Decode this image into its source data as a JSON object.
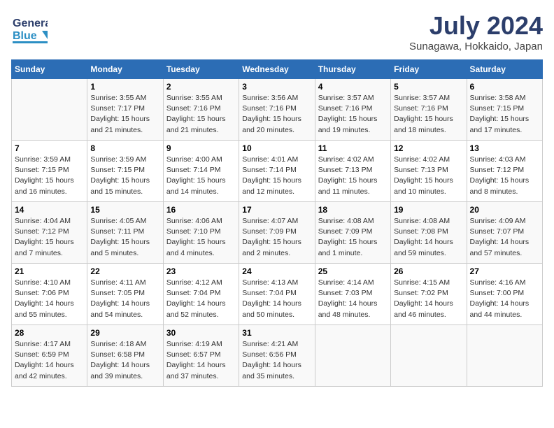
{
  "logo": {
    "line1": "General",
    "line2": "Blue"
  },
  "title": "July 2024",
  "subtitle": "Sunagawa, Hokkaido, Japan",
  "weekdays": [
    "Sunday",
    "Monday",
    "Tuesday",
    "Wednesday",
    "Thursday",
    "Friday",
    "Saturday"
  ],
  "weeks": [
    [
      {
        "day": "",
        "info": ""
      },
      {
        "day": "1",
        "info": "Sunrise: 3:55 AM\nSunset: 7:17 PM\nDaylight: 15 hours\nand 21 minutes."
      },
      {
        "day": "2",
        "info": "Sunrise: 3:55 AM\nSunset: 7:16 PM\nDaylight: 15 hours\nand 21 minutes."
      },
      {
        "day": "3",
        "info": "Sunrise: 3:56 AM\nSunset: 7:16 PM\nDaylight: 15 hours\nand 20 minutes."
      },
      {
        "day": "4",
        "info": "Sunrise: 3:57 AM\nSunset: 7:16 PM\nDaylight: 15 hours\nand 19 minutes."
      },
      {
        "day": "5",
        "info": "Sunrise: 3:57 AM\nSunset: 7:16 PM\nDaylight: 15 hours\nand 18 minutes."
      },
      {
        "day": "6",
        "info": "Sunrise: 3:58 AM\nSunset: 7:15 PM\nDaylight: 15 hours\nand 17 minutes."
      }
    ],
    [
      {
        "day": "7",
        "info": "Sunrise: 3:59 AM\nSunset: 7:15 PM\nDaylight: 15 hours\nand 16 minutes."
      },
      {
        "day": "8",
        "info": "Sunrise: 3:59 AM\nSunset: 7:15 PM\nDaylight: 15 hours\nand 15 minutes."
      },
      {
        "day": "9",
        "info": "Sunrise: 4:00 AM\nSunset: 7:14 PM\nDaylight: 15 hours\nand 14 minutes."
      },
      {
        "day": "10",
        "info": "Sunrise: 4:01 AM\nSunset: 7:14 PM\nDaylight: 15 hours\nand 12 minutes."
      },
      {
        "day": "11",
        "info": "Sunrise: 4:02 AM\nSunset: 7:13 PM\nDaylight: 15 hours\nand 11 minutes."
      },
      {
        "day": "12",
        "info": "Sunrise: 4:02 AM\nSunset: 7:13 PM\nDaylight: 15 hours\nand 10 minutes."
      },
      {
        "day": "13",
        "info": "Sunrise: 4:03 AM\nSunset: 7:12 PM\nDaylight: 15 hours\nand 8 minutes."
      }
    ],
    [
      {
        "day": "14",
        "info": "Sunrise: 4:04 AM\nSunset: 7:12 PM\nDaylight: 15 hours\nand 7 minutes."
      },
      {
        "day": "15",
        "info": "Sunrise: 4:05 AM\nSunset: 7:11 PM\nDaylight: 15 hours\nand 5 minutes."
      },
      {
        "day": "16",
        "info": "Sunrise: 4:06 AM\nSunset: 7:10 PM\nDaylight: 15 hours\nand 4 minutes."
      },
      {
        "day": "17",
        "info": "Sunrise: 4:07 AM\nSunset: 7:09 PM\nDaylight: 15 hours\nand 2 minutes."
      },
      {
        "day": "18",
        "info": "Sunrise: 4:08 AM\nSunset: 7:09 PM\nDaylight: 15 hours\nand 1 minute."
      },
      {
        "day": "19",
        "info": "Sunrise: 4:08 AM\nSunset: 7:08 PM\nDaylight: 14 hours\nand 59 minutes."
      },
      {
        "day": "20",
        "info": "Sunrise: 4:09 AM\nSunset: 7:07 PM\nDaylight: 14 hours\nand 57 minutes."
      }
    ],
    [
      {
        "day": "21",
        "info": "Sunrise: 4:10 AM\nSunset: 7:06 PM\nDaylight: 14 hours\nand 55 minutes."
      },
      {
        "day": "22",
        "info": "Sunrise: 4:11 AM\nSunset: 7:05 PM\nDaylight: 14 hours\nand 54 minutes."
      },
      {
        "day": "23",
        "info": "Sunrise: 4:12 AM\nSunset: 7:04 PM\nDaylight: 14 hours\nand 52 minutes."
      },
      {
        "day": "24",
        "info": "Sunrise: 4:13 AM\nSunset: 7:04 PM\nDaylight: 14 hours\nand 50 minutes."
      },
      {
        "day": "25",
        "info": "Sunrise: 4:14 AM\nSunset: 7:03 PM\nDaylight: 14 hours\nand 48 minutes."
      },
      {
        "day": "26",
        "info": "Sunrise: 4:15 AM\nSunset: 7:02 PM\nDaylight: 14 hours\nand 46 minutes."
      },
      {
        "day": "27",
        "info": "Sunrise: 4:16 AM\nSunset: 7:00 PM\nDaylight: 14 hours\nand 44 minutes."
      }
    ],
    [
      {
        "day": "28",
        "info": "Sunrise: 4:17 AM\nSunset: 6:59 PM\nDaylight: 14 hours\nand 42 minutes."
      },
      {
        "day": "29",
        "info": "Sunrise: 4:18 AM\nSunset: 6:58 PM\nDaylight: 14 hours\nand 39 minutes."
      },
      {
        "day": "30",
        "info": "Sunrise: 4:19 AM\nSunset: 6:57 PM\nDaylight: 14 hours\nand 37 minutes."
      },
      {
        "day": "31",
        "info": "Sunrise: 4:21 AM\nSunset: 6:56 PM\nDaylight: 14 hours\nand 35 minutes."
      },
      {
        "day": "",
        "info": ""
      },
      {
        "day": "",
        "info": ""
      },
      {
        "day": "",
        "info": ""
      }
    ]
  ]
}
